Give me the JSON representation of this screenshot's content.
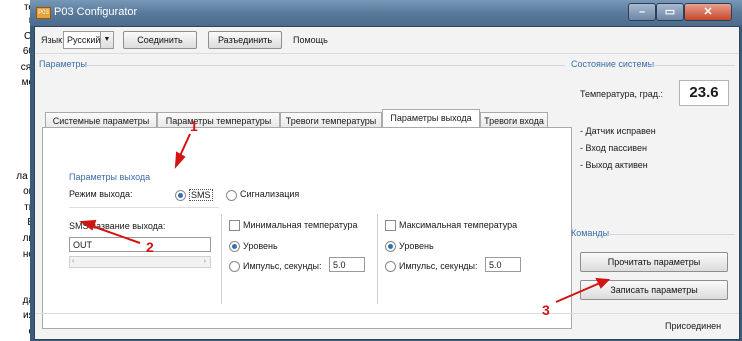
{
  "doc_fragments": [
    "те",
    "в",
    "С.",
    "60",
    "ся.",
    "мо",
    "ла \"",
    "ов",
    "ть",
    "В",
    "ли",
    "но",
    "да",
    "ия",
    "е"
  ],
  "window": {
    "title": "P03 Configurator",
    "app_icon_text": "P03"
  },
  "menubar": {
    "language_label": "Язык:",
    "language_value": "Русский",
    "connect_label": "Соединить",
    "disconnect_label": "Разъединить",
    "help_label": "Помощь"
  },
  "params_title": "Параметры",
  "tabs": [
    {
      "label": "Системные параметры"
    },
    {
      "label": "Параметры температуры"
    },
    {
      "label": "Тревоги температуры"
    },
    {
      "label": "Параметры выхода"
    },
    {
      "label": "Тревоги входа"
    }
  ],
  "output": {
    "group_title": "Параметры выхода",
    "mode_label": "Режим выхода:",
    "mode_sms": "SMS",
    "mode_alarm": "Сигнализация",
    "sms_name_label": "SMS название выхода:",
    "sms_name_value": "OUT",
    "min_temp_label": "Минимальная температура",
    "max_temp_label": "Максимальная температура",
    "level_label": "Уровень",
    "pulse_label": "Импульс, секунды:",
    "min_pulse_value": "5.0",
    "max_pulse_value": "5.0"
  },
  "system_state": {
    "title": "Состояние системы",
    "temp_label": "Температура, град.:",
    "temp_value": "23.6",
    "lines": [
      "- Датчик исправен",
      "- Вход пассивен",
      "- Выход активен"
    ]
  },
  "commands": {
    "title": "Команды",
    "read_label": "Прочитать параметры",
    "write_label": "Записать параметры"
  },
  "status_text": "Присоединен",
  "annotations": [
    "1",
    "2",
    "3"
  ],
  "colors": {
    "accent": "#3a6ea8",
    "annotation": "#d21414"
  }
}
